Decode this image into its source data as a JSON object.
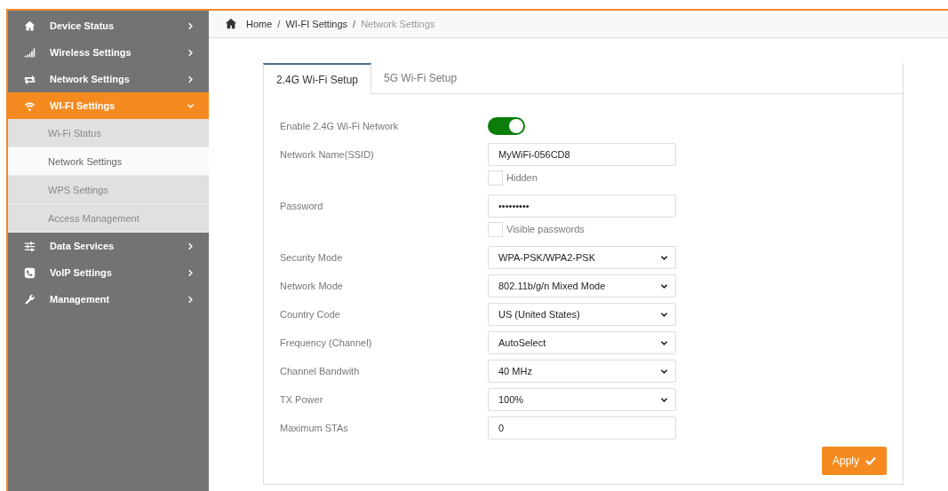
{
  "sidebar": {
    "items": [
      {
        "label": "Device Status",
        "expanded": false,
        "selected": false
      },
      {
        "label": "Wireless Settings",
        "expanded": false,
        "selected": false
      },
      {
        "label": "Network Settings",
        "expanded": false,
        "selected": false
      },
      {
        "label": "WI-FI Settings",
        "expanded": true,
        "selected": true,
        "children": [
          {
            "label": "Wi-Fi Status",
            "selected": false
          },
          {
            "label": "Network Settings",
            "selected": true
          },
          {
            "label": "WPS Settings",
            "selected": false
          },
          {
            "label": "Access Management",
            "selected": false
          }
        ]
      },
      {
        "label": "Data Services",
        "expanded": false,
        "selected": false
      },
      {
        "label": "VoIP Settings",
        "expanded": false,
        "selected": false
      },
      {
        "label": "Management",
        "expanded": false,
        "selected": false
      }
    ]
  },
  "breadcrumb": [
    "Home",
    "/",
    "WI-FI Settings",
    "/",
    "Network Settings"
  ],
  "tabs": [
    {
      "label": "2.4G Wi-Fi Setup",
      "selected": true
    },
    {
      "label": "5G Wi-Fi Setup",
      "selected": false
    }
  ],
  "form": [
    {
      "kind": "toggle",
      "label": "Enable 2.4G Wi-Fi Network",
      "on": true
    },
    {
      "kind": "text",
      "label": "Network Name(SSID)",
      "value": "MyWiFi-056CD8",
      "option": {
        "label": "Hidden",
        "checked": false
      }
    },
    {
      "kind": "text",
      "label": "Password",
      "value": "•••••••••",
      "option": {
        "label": "Visible passwords",
        "checked": false
      }
    },
    {
      "kind": "select",
      "label": "Security Mode",
      "value": "WPA-PSK/WPA2-PSK"
    },
    {
      "kind": "select",
      "label": "Network Mode",
      "value": "802.11b/g/n Mixed Mode"
    },
    {
      "kind": "select",
      "label": "Country Code",
      "value": "US (United States)"
    },
    {
      "kind": "select",
      "label": "Frequency (Channel)",
      "value": "AutoSelect"
    },
    {
      "kind": "select",
      "label": "Channel Bandwith",
      "value": "40 MHz"
    },
    {
      "kind": "select",
      "label": "TX Power",
      "value": "100%"
    },
    {
      "kind": "text",
      "label": "Maximum STAs",
      "value": "0"
    }
  ],
  "apply_button": "Apply"
}
